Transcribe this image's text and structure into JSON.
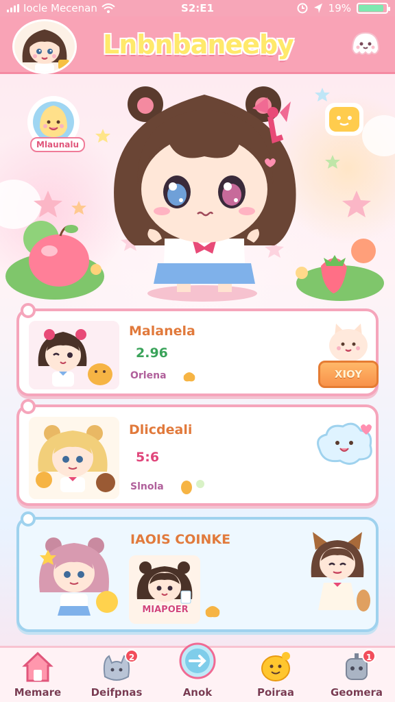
{
  "status_bar": {
    "carrier": "Iocle Mecenan",
    "time": "S2:E1",
    "battery": "19%",
    "battery_level": 0.9
  },
  "header": {
    "app_title": "Lnbnbaneeby"
  },
  "hero": {
    "badge_label": "Mlaunalu"
  },
  "cards": [
    {
      "title": "Malanela",
      "value": "2.96",
      "sub_label": "Orlena",
      "button_label": "XIOY"
    },
    {
      "title": "Dlicdeali",
      "value": "5:6",
      "sub_label": "Slnola"
    },
    {
      "title": "IAOIS COINKE",
      "thumb_label": "MIAPOER"
    }
  ],
  "bottom_nav": [
    {
      "label": "Memare",
      "icon": "house-icon"
    },
    {
      "label": "Deifpnas",
      "icon": "cat-ghost-icon",
      "badge": "2"
    },
    {
      "label": "Anok",
      "icon": "arrow-right-icon"
    },
    {
      "label": "Poiraa",
      "icon": "smiley-blob-icon"
    },
    {
      "label": "Geomera",
      "icon": "robot-icon",
      "badge": "1"
    }
  ],
  "colors": {
    "header": "#f9a3b6",
    "card_border_pink": "#f5a5bb",
    "card_border_blue": "#9fd2ee",
    "title_orange": "#e17a3c",
    "value_green": "#3aa35a",
    "value_pink": "#e0457a"
  }
}
